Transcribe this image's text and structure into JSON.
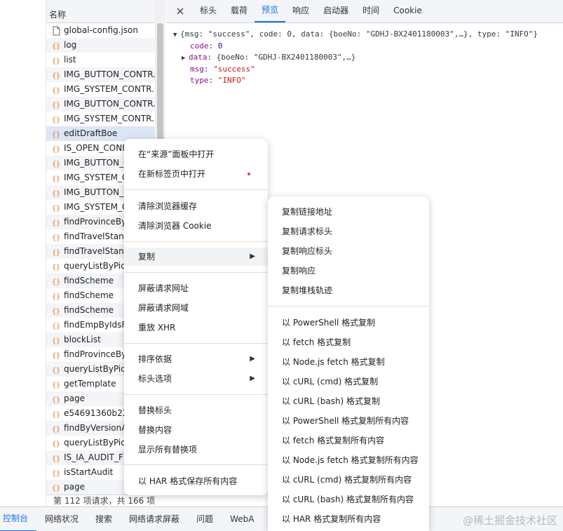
{
  "network_list": {
    "header": "名称",
    "rows": [
      {
        "name": "global-config.json",
        "icon": "file-icon"
      },
      {
        "name": "log",
        "icon": "xhr-icon"
      },
      {
        "name": "list",
        "icon": "xhr-icon"
      },
      {
        "name": "IMG_BUTTON_CONTR...",
        "icon": "xhr-icon"
      },
      {
        "name": "IMG_SYSTEM_CONTR...",
        "icon": "xhr-icon"
      },
      {
        "name": "IMG_BUTTON_CONTR...",
        "icon": "xhr-icon"
      },
      {
        "name": "IMG_SYSTEM_CONTR...",
        "icon": "xhr-icon"
      },
      {
        "name": "editDraftBoe",
        "icon": "xhr-icon"
      },
      {
        "name": "IS_OPEN_CONFIG",
        "icon": "xhr-icon"
      },
      {
        "name": "IMG_BUTTON_CO",
        "icon": "xhr-icon"
      },
      {
        "name": "IMG_SYSTEM_CO",
        "icon": "xhr-icon"
      },
      {
        "name": "IMG_BUTTON_CO",
        "icon": "xhr-icon"
      },
      {
        "name": "IMG_SYSTEM_CO",
        "icon": "xhr-icon"
      },
      {
        "name": "findProvinceByC",
        "icon": "xhr-icon"
      },
      {
        "name": "findTravelStanda",
        "icon": "xhr-icon"
      },
      {
        "name": "findTravelStanda",
        "icon": "xhr-icon"
      },
      {
        "name": "queryListByPidAr",
        "icon": "xhr-icon"
      },
      {
        "name": "findScheme",
        "icon": "xhr-icon"
      },
      {
        "name": "findScheme",
        "icon": "xhr-icon"
      },
      {
        "name": "findScheme",
        "icon": "xhr-icon"
      },
      {
        "name": "findEmpByIdsFor",
        "icon": "xhr-icon"
      },
      {
        "name": "blockList",
        "icon": "xhr-icon"
      },
      {
        "name": "findProvinceByC",
        "icon": "xhr-icon"
      },
      {
        "name": "queryListByPidAr",
        "icon": "xhr-icon"
      },
      {
        "name": "getTemplate",
        "icon": "xhr-icon"
      },
      {
        "name": "page",
        "icon": "xhr-icon"
      },
      {
        "name": "e54691360b2234",
        "icon": "xhr-icon"
      },
      {
        "name": "findByVersionAn",
        "icon": "xhr-icon"
      },
      {
        "name": "queryListByPidAr",
        "icon": "xhr-icon"
      },
      {
        "name": "IS_IA_AUDIT_FLA",
        "icon": "xhr-icon"
      },
      {
        "name": "isStartAudit",
        "icon": "xhr-icon"
      },
      {
        "name": "page",
        "icon": "xhr-icon"
      }
    ],
    "selected_index": 7,
    "status": "第 112 项请求，共 166 项"
  },
  "detail": {
    "tabs": [
      "标头",
      "载荷",
      "预览",
      "响应",
      "启动器",
      "时间",
      "Cookie"
    ],
    "active_tab": "预览",
    "preview": {
      "summary": "{msg: \"success\", code: 0, data: {boeNo: \"GDHJ-BX2401180003\",…}, type: \"INFO\"}",
      "code_key": "code",
      "code_val": "0",
      "data_key": "data",
      "data_val": "{boeNo: \"GDHJ-BX2401180003\",…}",
      "msg_key": "msg",
      "msg_val": "\"success\"",
      "type_key": "type",
      "type_val": "\"INFO\""
    }
  },
  "context_menu": {
    "open_in_sources": "在“来源”面板中打开",
    "open_in_new_tab": "在新标签页中打开",
    "clear_cache": "清除浏览器缓存",
    "clear_cookies": "清除浏览器 Cookie",
    "copy": "复制",
    "block_url": "屏蔽请求网址",
    "block_domain": "屏蔽请求网域",
    "replay_xhr": "重放 XHR",
    "sort_by": "排序依据",
    "header_options": "标头选项",
    "override_headers": "替换标头",
    "override_content": "替换内容",
    "show_all_overrides": "显示所有替换项",
    "save_har": "以 HAR 格式保存所有内容"
  },
  "copy_submenu": {
    "items_a": [
      "复制链接地址",
      "复制请求标头",
      "复制响应标头",
      "复制响应",
      "复制堆栈轨迹"
    ],
    "items_b": [
      "以 PowerShell 格式复制",
      "以 fetch 格式复制",
      "以 Node.js fetch 格式复制",
      "以 cURL (cmd) 格式复制",
      "以 cURL (bash) 格式复制",
      "以 PowerShell 格式复制所有内容",
      "以 fetch 格式复制所有内容",
      "以 Node.js fetch 格式复制所有内容",
      "以 cURL (cmd) 格式复制所有内容",
      "以 cURL (bash) 格式复制所有内容",
      "以 HAR 格式复制所有内容"
    ]
  },
  "drawer_tabs": [
    "控制台",
    "网络状况",
    "搜索",
    "网络请求屏蔽",
    "问题",
    "WebA"
  ],
  "watermark": "@稀土掘金技术社区",
  "colors": {
    "accent": "#1a73e8",
    "xhr_icon": "#e8710a",
    "string": "#c41a16",
    "number": "#1a1aa6",
    "key": "#881391"
  }
}
